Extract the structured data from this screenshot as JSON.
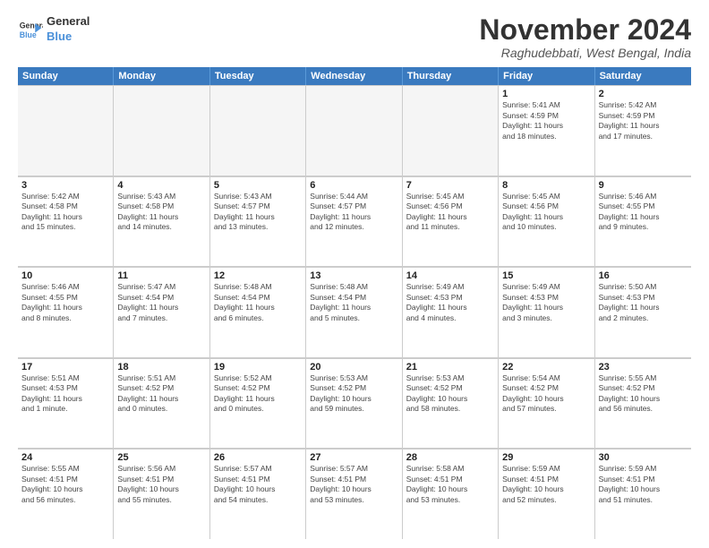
{
  "logo": {
    "line1": "General",
    "line2": "Blue"
  },
  "title": "November 2024",
  "location": "Raghudebbati, West Bengal, India",
  "header": {
    "days": [
      "Sunday",
      "Monday",
      "Tuesday",
      "Wednesday",
      "Thursday",
      "Friday",
      "Saturday"
    ]
  },
  "rows": [
    {
      "cells": [
        {
          "day": "",
          "content": "",
          "empty": true
        },
        {
          "day": "",
          "content": "",
          "empty": true
        },
        {
          "day": "",
          "content": "",
          "empty": true
        },
        {
          "day": "",
          "content": "",
          "empty": true
        },
        {
          "day": "",
          "content": "",
          "empty": true
        },
        {
          "day": "1",
          "content": "Sunrise: 5:41 AM\nSunset: 4:59 PM\nDaylight: 11 hours\nand 18 minutes.",
          "empty": false
        },
        {
          "day": "2",
          "content": "Sunrise: 5:42 AM\nSunset: 4:59 PM\nDaylight: 11 hours\nand 17 minutes.",
          "empty": false
        }
      ]
    },
    {
      "cells": [
        {
          "day": "3",
          "content": "Sunrise: 5:42 AM\nSunset: 4:58 PM\nDaylight: 11 hours\nand 15 minutes.",
          "empty": false
        },
        {
          "day": "4",
          "content": "Sunrise: 5:43 AM\nSunset: 4:58 PM\nDaylight: 11 hours\nand 14 minutes.",
          "empty": false
        },
        {
          "day": "5",
          "content": "Sunrise: 5:43 AM\nSunset: 4:57 PM\nDaylight: 11 hours\nand 13 minutes.",
          "empty": false
        },
        {
          "day": "6",
          "content": "Sunrise: 5:44 AM\nSunset: 4:57 PM\nDaylight: 11 hours\nand 12 minutes.",
          "empty": false
        },
        {
          "day": "7",
          "content": "Sunrise: 5:45 AM\nSunset: 4:56 PM\nDaylight: 11 hours\nand 11 minutes.",
          "empty": false
        },
        {
          "day": "8",
          "content": "Sunrise: 5:45 AM\nSunset: 4:56 PM\nDaylight: 11 hours\nand 10 minutes.",
          "empty": false
        },
        {
          "day": "9",
          "content": "Sunrise: 5:46 AM\nSunset: 4:55 PM\nDaylight: 11 hours\nand 9 minutes.",
          "empty": false
        }
      ]
    },
    {
      "cells": [
        {
          "day": "10",
          "content": "Sunrise: 5:46 AM\nSunset: 4:55 PM\nDaylight: 11 hours\nand 8 minutes.",
          "empty": false
        },
        {
          "day": "11",
          "content": "Sunrise: 5:47 AM\nSunset: 4:54 PM\nDaylight: 11 hours\nand 7 minutes.",
          "empty": false
        },
        {
          "day": "12",
          "content": "Sunrise: 5:48 AM\nSunset: 4:54 PM\nDaylight: 11 hours\nand 6 minutes.",
          "empty": false
        },
        {
          "day": "13",
          "content": "Sunrise: 5:48 AM\nSunset: 4:54 PM\nDaylight: 11 hours\nand 5 minutes.",
          "empty": false
        },
        {
          "day": "14",
          "content": "Sunrise: 5:49 AM\nSunset: 4:53 PM\nDaylight: 11 hours\nand 4 minutes.",
          "empty": false
        },
        {
          "day": "15",
          "content": "Sunrise: 5:49 AM\nSunset: 4:53 PM\nDaylight: 11 hours\nand 3 minutes.",
          "empty": false
        },
        {
          "day": "16",
          "content": "Sunrise: 5:50 AM\nSunset: 4:53 PM\nDaylight: 11 hours\nand 2 minutes.",
          "empty": false
        }
      ]
    },
    {
      "cells": [
        {
          "day": "17",
          "content": "Sunrise: 5:51 AM\nSunset: 4:53 PM\nDaylight: 11 hours\nand 1 minute.",
          "empty": false
        },
        {
          "day": "18",
          "content": "Sunrise: 5:51 AM\nSunset: 4:52 PM\nDaylight: 11 hours\nand 0 minutes.",
          "empty": false
        },
        {
          "day": "19",
          "content": "Sunrise: 5:52 AM\nSunset: 4:52 PM\nDaylight: 11 hours\nand 0 minutes.",
          "empty": false
        },
        {
          "day": "20",
          "content": "Sunrise: 5:53 AM\nSunset: 4:52 PM\nDaylight: 10 hours\nand 59 minutes.",
          "empty": false
        },
        {
          "day": "21",
          "content": "Sunrise: 5:53 AM\nSunset: 4:52 PM\nDaylight: 10 hours\nand 58 minutes.",
          "empty": false
        },
        {
          "day": "22",
          "content": "Sunrise: 5:54 AM\nSunset: 4:52 PM\nDaylight: 10 hours\nand 57 minutes.",
          "empty": false
        },
        {
          "day": "23",
          "content": "Sunrise: 5:55 AM\nSunset: 4:52 PM\nDaylight: 10 hours\nand 56 minutes.",
          "empty": false
        }
      ]
    },
    {
      "cells": [
        {
          "day": "24",
          "content": "Sunrise: 5:55 AM\nSunset: 4:51 PM\nDaylight: 10 hours\nand 56 minutes.",
          "empty": false
        },
        {
          "day": "25",
          "content": "Sunrise: 5:56 AM\nSunset: 4:51 PM\nDaylight: 10 hours\nand 55 minutes.",
          "empty": false
        },
        {
          "day": "26",
          "content": "Sunrise: 5:57 AM\nSunset: 4:51 PM\nDaylight: 10 hours\nand 54 minutes.",
          "empty": false
        },
        {
          "day": "27",
          "content": "Sunrise: 5:57 AM\nSunset: 4:51 PM\nDaylight: 10 hours\nand 53 minutes.",
          "empty": false
        },
        {
          "day": "28",
          "content": "Sunrise: 5:58 AM\nSunset: 4:51 PM\nDaylight: 10 hours\nand 53 minutes.",
          "empty": false
        },
        {
          "day": "29",
          "content": "Sunrise: 5:59 AM\nSunset: 4:51 PM\nDaylight: 10 hours\nand 52 minutes.",
          "empty": false
        },
        {
          "day": "30",
          "content": "Sunrise: 5:59 AM\nSunset: 4:51 PM\nDaylight: 10 hours\nand 51 minutes.",
          "empty": false
        }
      ]
    }
  ]
}
